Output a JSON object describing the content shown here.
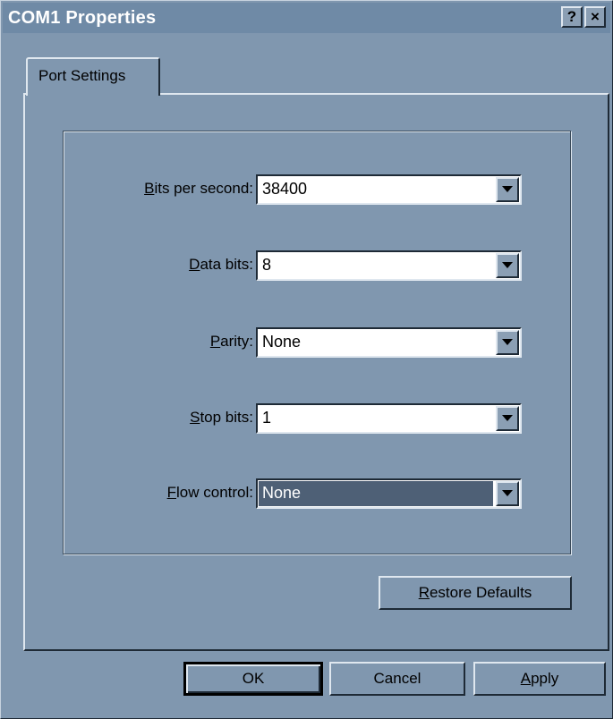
{
  "window": {
    "title": "COM1 Properties",
    "help_glyph": "?",
    "close_glyph": "×"
  },
  "tabs": [
    {
      "label": "Port Settings",
      "active": true
    }
  ],
  "fields": [
    {
      "label_mnemonic": "B",
      "label_rest": "its per second:",
      "value": "38400",
      "focused": false
    },
    {
      "label_mnemonic": "D",
      "label_rest": "ata bits:",
      "value": "8",
      "focused": false
    },
    {
      "label_mnemonic": "P",
      "label_rest": "arity:",
      "value": "None",
      "focused": false
    },
    {
      "label_mnemonic": "S",
      "label_rest": "top bits:",
      "value": "1",
      "focused": false
    },
    {
      "label_mnemonic": "F",
      "label_rest": "low control:",
      "value": "None",
      "focused": true
    }
  ],
  "buttons": {
    "restore_mnemonic": "R",
    "restore_rest": "estore Defaults",
    "ok": "OK",
    "cancel": "Cancel",
    "apply_mnemonic": "A",
    "apply_rest": "pply"
  },
  "colors": {
    "face": "#8097af",
    "highlight_selection": "#4e6076",
    "title_bar": "#6f8aa6"
  }
}
